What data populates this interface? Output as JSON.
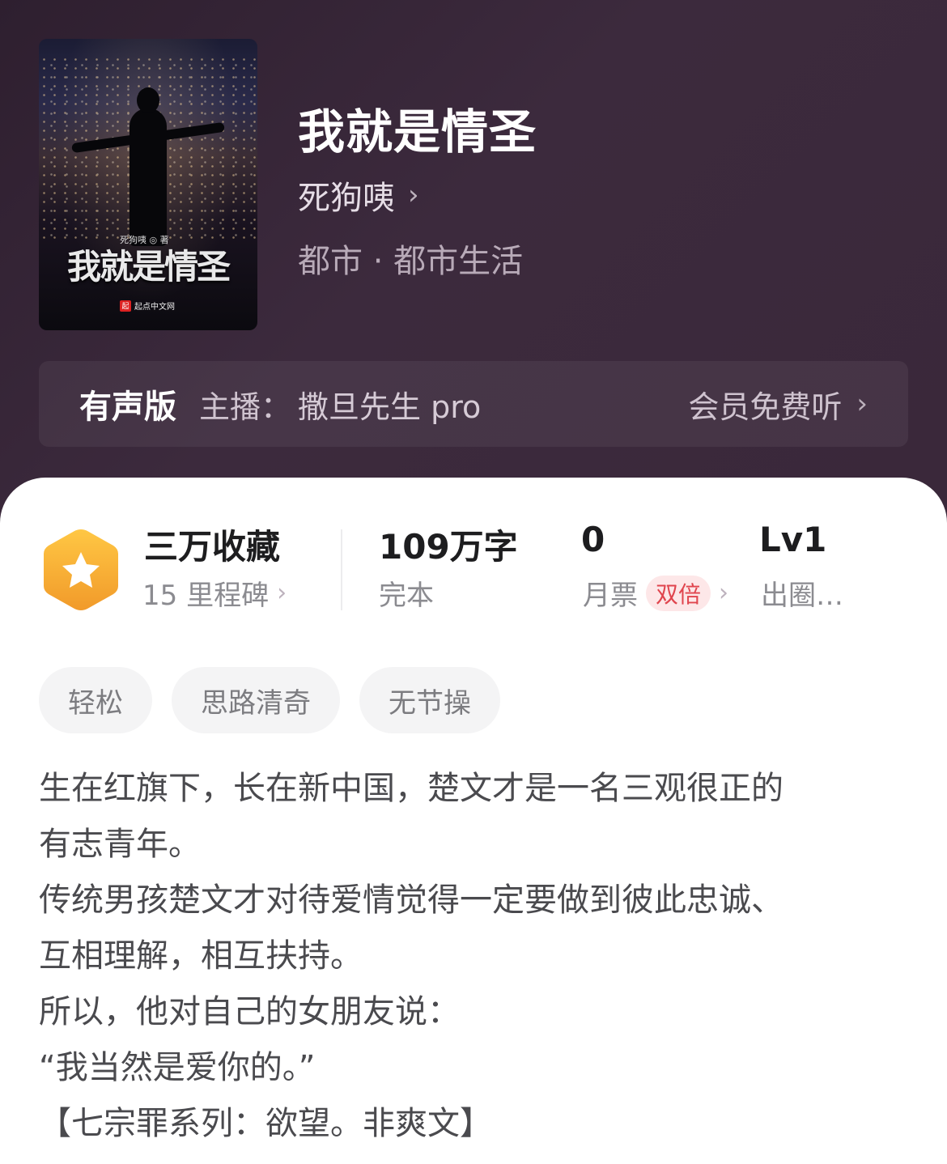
{
  "book": {
    "title": "我就是情圣",
    "author": "死狗咦",
    "genre": "都市 · 都市生活",
    "cover": {
      "title": "我就是情圣",
      "author_line": "死狗咦 ◎ 著",
      "publisher": "起点中文网",
      "publisher_logo": "起"
    }
  },
  "audio": {
    "label": "有声版",
    "host_prefix": "主播：",
    "host_name": "撒旦先生 pro",
    "action": "会员免费听"
  },
  "stats": {
    "favorites": {
      "main": "三万收藏",
      "sub": "15 里程碑"
    },
    "words": {
      "main": "109万字",
      "sub": "完本"
    },
    "monthly_ticket": {
      "main": "0",
      "sub": "月票",
      "badge": "双倍"
    },
    "level": {
      "main": "Lv1",
      "sub": "出圈…"
    }
  },
  "tags": [
    "轻松",
    "思路清奇",
    "无节操"
  ],
  "intro": [
    "生在红旗下，长在新中国，楚文才是一名三观很正的",
    "有志青年。",
    "传统男孩楚文才对待爱情觉得一定要做到彼此忠诚、",
    "互相理解，相互扶持。",
    "所以，他对自己的女朋友说：",
    "“我当然是爱你的。”",
    "【七宗罪系列：欲望。非爽文】"
  ],
  "colors": {
    "header_bg": "#3a283a",
    "badge_orange": "#f5a623",
    "accent_red": "#e0454e"
  }
}
